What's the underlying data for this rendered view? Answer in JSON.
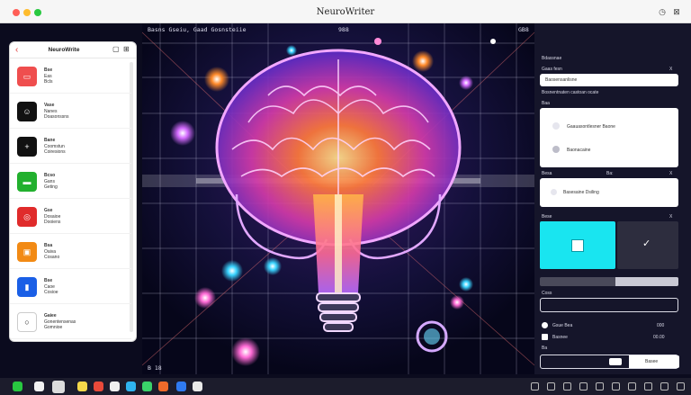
{
  "window": {
    "title": "NeuroWriter"
  },
  "left_panel": {
    "title": "NeuroWrite",
    "items": [
      {
        "icon": "message-icon",
        "color": "#ef4e4e",
        "line1": "Bse",
        "line2": "Eas",
        "line3": "Bcls"
      },
      {
        "icon": "user-icon",
        "color": "#111111",
        "line1": "Vase",
        "line2": "Nanes",
        "line3": "Doasonssns"
      },
      {
        "icon": "plus-icon",
        "color": "#111111",
        "line1": "Bane",
        "line2": "Coomstun",
        "line3": "Coiresions"
      },
      {
        "icon": "card-icon",
        "color": "#22b02e",
        "line1": "Bcso",
        "line2": "Gans",
        "line3": "Geting"
      },
      {
        "icon": "target-icon",
        "color": "#e02b2b",
        "line1": "Gse",
        "line2": "Dosaioe",
        "line3": "Dooiens"
      },
      {
        "icon": "chat-icon",
        "color": "#f28a14",
        "line1": "Bsa",
        "line2": "Oaiva",
        "line3": "Cosano"
      },
      {
        "icon": "chart-icon",
        "color": "#1a5fe6",
        "line1": "Bse",
        "line2": "Caoe",
        "line3": "Cosioe"
      },
      {
        "icon": "circle-icon",
        "color": "#ffffff",
        "line1": "Gaiee",
        "line2": "Gonentensenas",
        "line3": "Gomnioe"
      }
    ]
  },
  "canvas": {
    "label_left": "Basns Gseiu, Gaad  Gosnsteiie",
    "label_mid": "988",
    "label_right": "GB8",
    "label_bottom": "B 18"
  },
  "right_panel": {
    "section1": "Bdassnae",
    "field1_label": "Gaas fesn",
    "field1_x": "X",
    "field1_value": "Baosensanlisne",
    "field1_note": "Bosnentnaten castoan ocate",
    "section2": "Baa",
    "radio1": "Gaauasontlesner Baone",
    "radio2": "Baonacaine",
    "section3": "Besa",
    "section3_mark": "Ba:",
    "field3_value": "Basesaine Dsiling",
    "section4": "Bese",
    "check_label": "✓",
    "sliders_label": "Coss",
    "row1_label": "Gsue Bea",
    "row1_value": "000",
    "row2_label": "Basnee",
    "row2_value": "00.00",
    "section5": "Ba",
    "button_label": "Basee",
    "accent_color": "#19e5f0"
  },
  "colors": {
    "dock_bg": "#1c1c2c",
    "panel_bg": "#15152a"
  }
}
